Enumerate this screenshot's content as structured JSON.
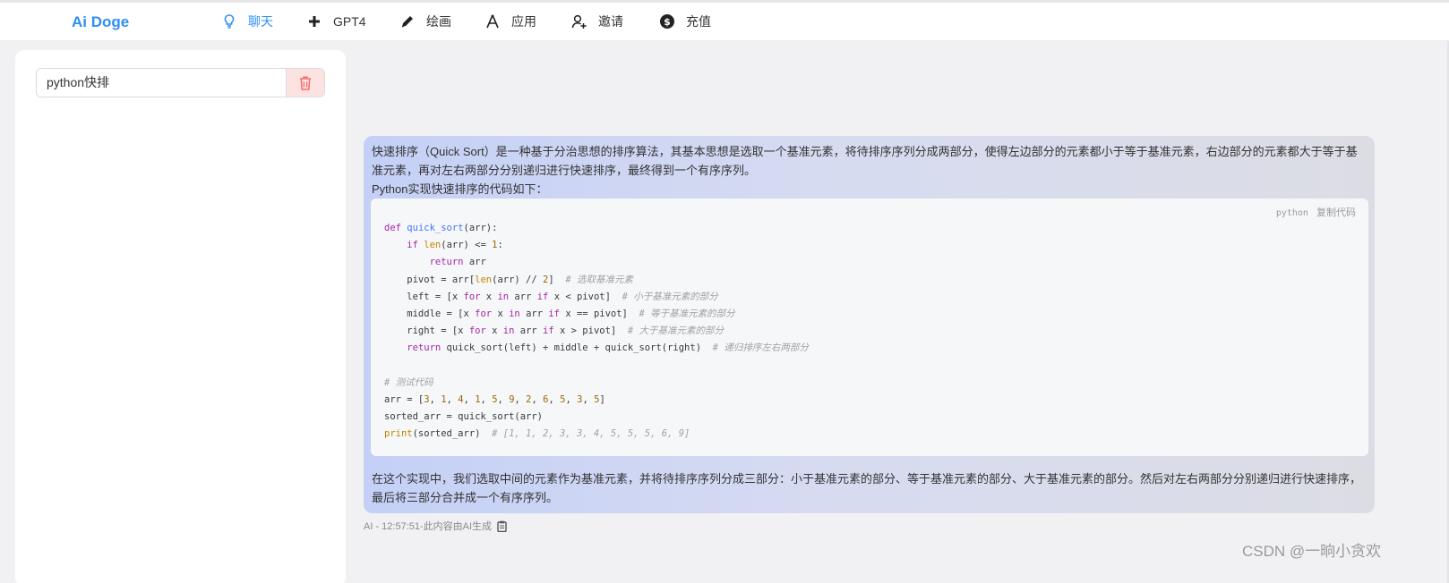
{
  "app": {
    "brand": "Ai Doge"
  },
  "nav": {
    "items": [
      {
        "label": "聊天",
        "icon": "bulb-icon",
        "active": true
      },
      {
        "label": "GPT4",
        "icon": "plus-icon",
        "active": false
      },
      {
        "label": "绘画",
        "icon": "pen-icon",
        "active": false
      },
      {
        "label": "应用",
        "icon": "compass-icon",
        "active": false
      },
      {
        "label": "邀请",
        "icon": "add-user-icon",
        "active": false
      },
      {
        "label": "充值",
        "icon": "dollar-icon",
        "active": false
      }
    ]
  },
  "sidebar": {
    "conversations": [
      {
        "title": "python快排"
      }
    ]
  },
  "message": {
    "intro": "快速排序（Quick Sort）是一种基于分治思想的排序算法，其基本思想是选取一个基准元素，将待排序序列分成两部分，使得左边部分的元素都小于等于基准元素，右边部分的元素都大于等于基准元素，再对左右两部分分别递归进行快速排序，最终得到一个有序序列。",
    "code_intro": "Python实现快速排序的代码如下：",
    "code_lang": "python",
    "copy_label": "复制代码",
    "code_lines": [
      "def quick_sort(arr):",
      "    if len(arr) <= 1:",
      "        return arr",
      "    pivot = arr[len(arr) // 2]  # 选取基准元素",
      "    left = [x for x in arr if x < pivot]  # 小于基准元素的部分",
      "    middle = [x for x in arr if x == pivot]  # 等于基准元素的部分",
      "    right = [x for x in arr if x > pivot]  # 大于基准元素的部分",
      "    return quick_sort(left) + middle + quick_sort(right)  # 递归排序左右两部分",
      "",
      "# 测试代码",
      "arr = [3, 1, 4, 1, 5, 9, 2, 6, 5, 3, 5]",
      "sorted_arr = quick_sort(arr)",
      "print(sorted_arr)  # [1, 1, 2, 3, 3, 4, 5, 5, 5, 6, 9]"
    ],
    "outro": "在这个实现中，我们选取中间的元素作为基准元素，并将待排序序列分成三部分：小于基准元素的部分、等于基准元素的部分、大于基准元素的部分。然后对左右两部分分别递归进行快速排序，最后将三部分合并成一个有序序列。",
    "meta": "AI - 12:57:51-此内容由AI生成"
  },
  "watermark": "CSDN @一晌小贪欢",
  "colors": {
    "accent": "#2f8ef4",
    "delete_bg": "#fde2e2",
    "delete_icon": "#f56c6c"
  }
}
